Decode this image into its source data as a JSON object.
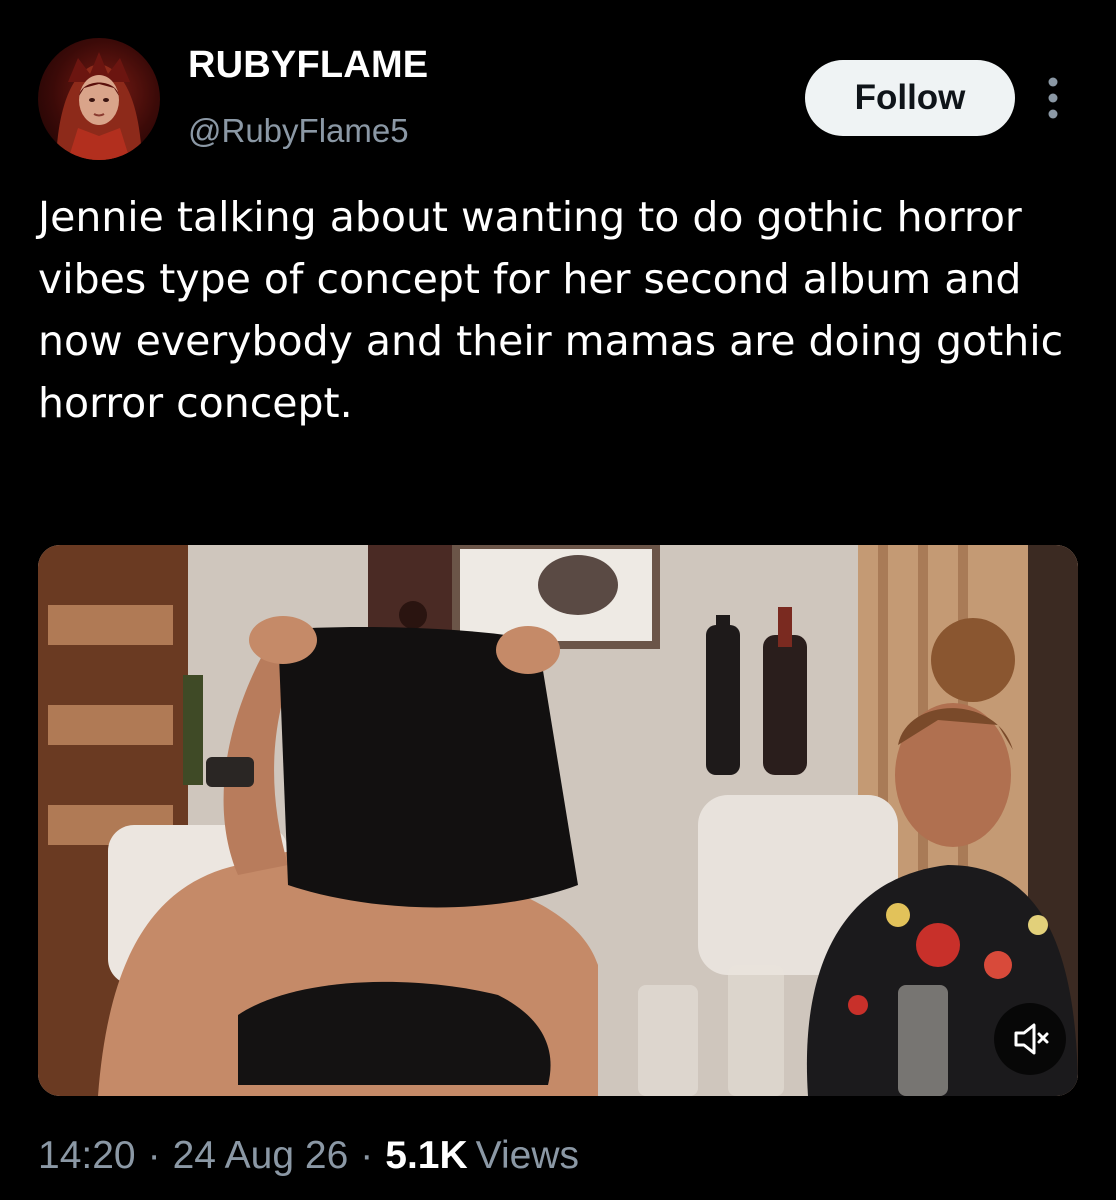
{
  "tweet": {
    "author": {
      "display_name": "RUBYFLAME",
      "handle": "@RubyFlame5"
    },
    "follow_label": "Follow",
    "text": "Jennie talking about wanting to do gothic horror vibes type of concept for her second album and now everybody and their mamas are doing gothic horror concept.",
    "media": {
      "type": "video",
      "muted_icon": "speaker-muted-icon"
    },
    "time": "14:20",
    "date": "24 Aug 26",
    "separator": "·",
    "views_count": "5.1K",
    "views_label": "Views"
  },
  "colors": {
    "background": "#000000",
    "primary_text": "#ffffff",
    "secondary_text": "#8b98a5",
    "follow_button_bg": "#eff3f4",
    "follow_button_text": "#0f1419"
  },
  "icons": [
    "more-options-icon",
    "speaker-muted-icon"
  ]
}
